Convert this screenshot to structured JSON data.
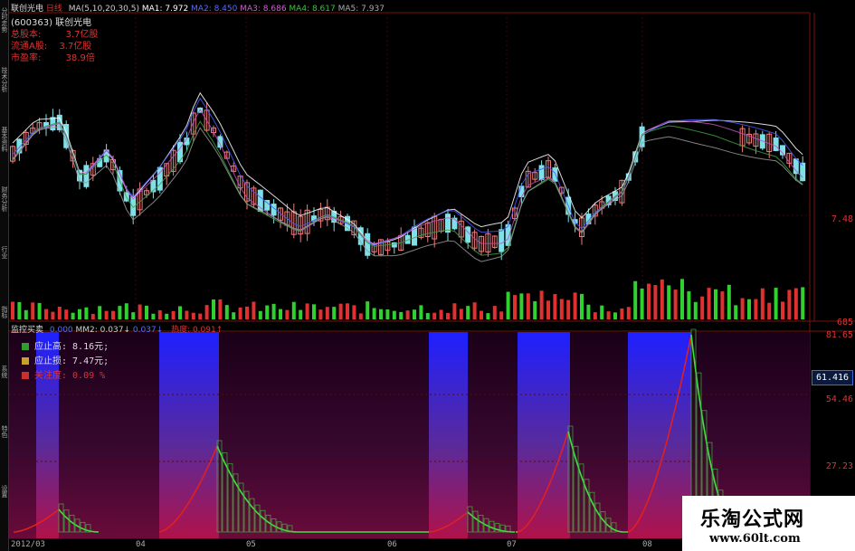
{
  "left_tabs": [
    "分时走势",
    "技术分析",
    "基本资料",
    "财务分析",
    "行业",
    "指标",
    "系统",
    "特色",
    "设置"
  ],
  "header": {
    "stock_name": "联创光电",
    "period": "日线",
    "ma_label": "MA(5,10,20,30,5)",
    "ma1": "MA1: 7.972",
    "ma2": "MA2: 8.450",
    "ma3": "MA3: 8.686",
    "ma4": "MA4: 8.617",
    "ma5": "MA5: 7.937"
  },
  "info": {
    "code_line": "(600363)",
    "code_name": "联创光电",
    "total_label": "总股本:",
    "total_value": "3.7亿股",
    "float_label": "流通A股:",
    "float_value": "3.7亿股",
    "pe_label": "市盈率:",
    "pe_value": "38.9倍"
  },
  "price_axis": {
    "top_label": "7.48",
    "bottom_label": "685"
  },
  "indicator_header": {
    "name": "监控买卖",
    "v1": "0.000",
    "v2": "MM2: 0.037↓",
    "v3": "0.037↓",
    "v4": "热度: 0.091↑"
  },
  "indicator_axis": [
    "81.65",
    "54.46",
    "27.23"
  ],
  "indicator_current": "61.416",
  "legend": [
    {
      "label": "应止高: 8.16元;",
      "color": "#2e9c2e"
    },
    {
      "label": "应止损: 7.47元;",
      "color": "#c8a030"
    },
    {
      "label": "关注度: 0.09 %",
      "color": "#c83030"
    }
  ],
  "dates": [
    "2012/03",
    "04",
    "05",
    "06",
    "07",
    "08"
  ],
  "watermark": {
    "title": "乐淘公式网",
    "url": "www.60lt.com"
  },
  "colors": {
    "up": "#f07a7a",
    "down": "#7fe0e8",
    "vol_up": "#e03030",
    "vol_down": "#30d030",
    "blue_band": "#2a2ae0",
    "red_curve": "#e02020",
    "green_curve": "#40e040"
  }
}
